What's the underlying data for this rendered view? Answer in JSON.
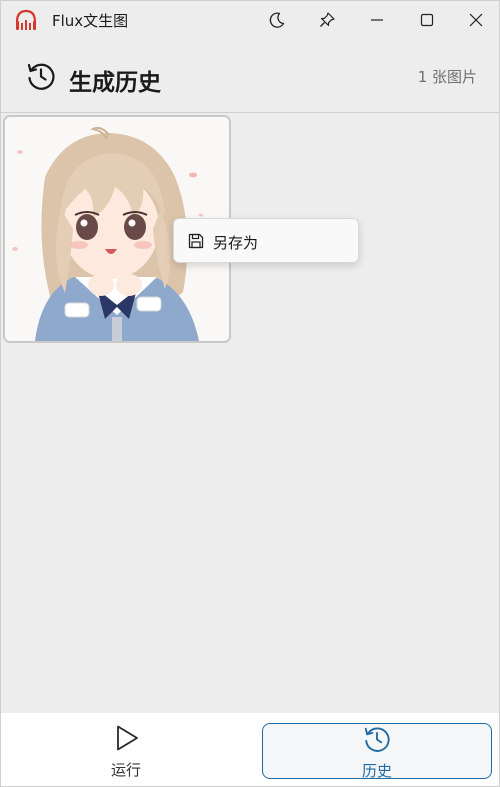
{
  "window": {
    "title": "Flux文生图",
    "controls": [
      "moon-icon",
      "pin-icon",
      "minimize-icon",
      "maximize-icon",
      "close-icon"
    ]
  },
  "header": {
    "icon": "history-icon",
    "title": "生成历史",
    "count": "1 张图片"
  },
  "gallery": {
    "items": [
      {
        "icon": "anime-girl-image"
      }
    ]
  },
  "context_menu": {
    "items": [
      {
        "label": "另存为",
        "icon": "save-icon"
      }
    ]
  },
  "bottom_nav": {
    "items": [
      {
        "label": "运行",
        "icon": "play-icon",
        "active": false
      },
      {
        "label": "历史",
        "icon": "history-icon",
        "active": true
      }
    ]
  },
  "colors": {
    "accent": "#1f6ba3",
    "app_icon": "#d7382c",
    "background": "#ededed"
  }
}
